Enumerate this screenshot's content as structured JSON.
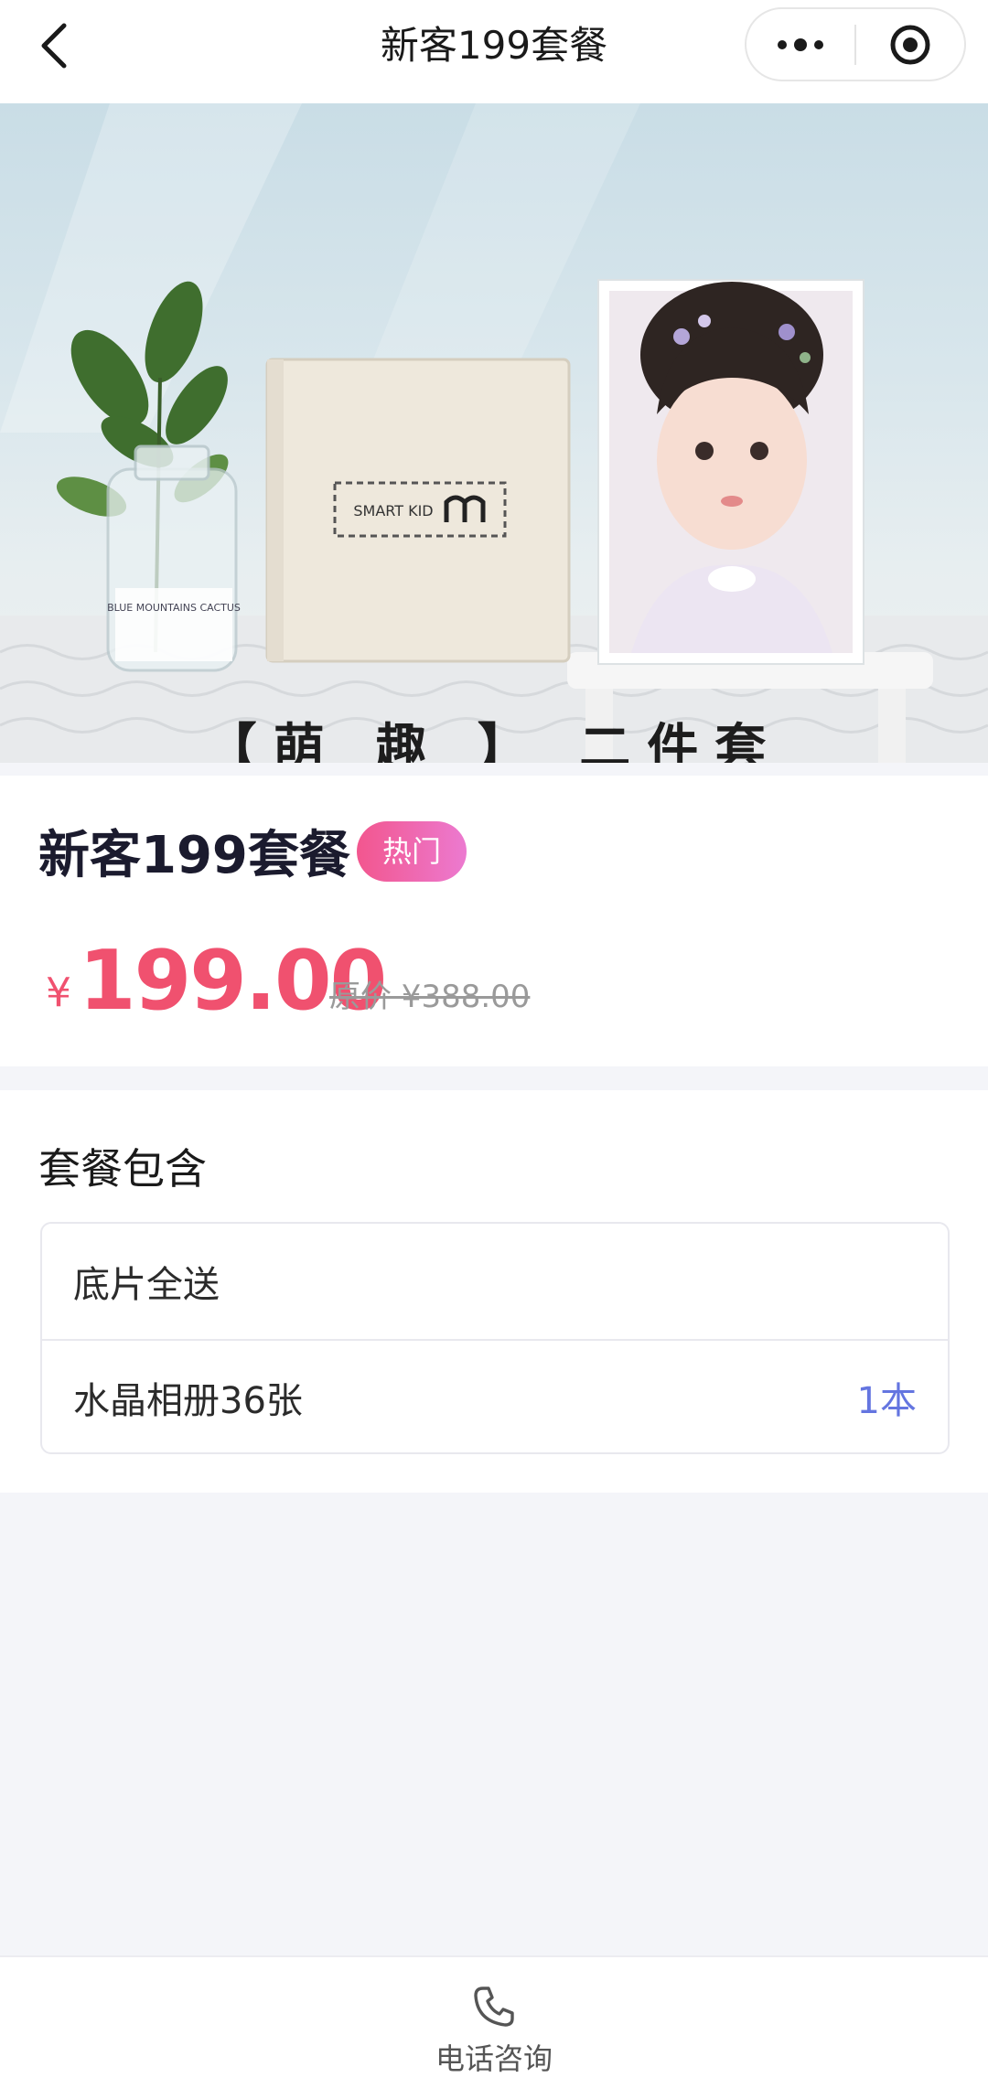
{
  "nav": {
    "title": "新客199套餐",
    "back_icon": "chevron-left-icon",
    "more_icon": "more-dots-icon",
    "close_icon": "target-circle-icon"
  },
  "banner": {
    "caption": "【萌 趣 】 二件套",
    "album_brand": "SMART KID",
    "vase_label": "BLUE MOUNTAINS CACTUS"
  },
  "package": {
    "title": "新客199套餐",
    "badge": "热门",
    "currency": "¥",
    "price": "199.00",
    "original_price": "原价 ¥388.00"
  },
  "contents": {
    "title": "套餐包含",
    "items": [
      {
        "name": "底片全送",
        "qty": ""
      },
      {
        "name": "水晶相册36张",
        "qty": "1本"
      }
    ]
  },
  "bottom": {
    "consult_label": "电话咨询",
    "consult_icon": "phone-icon"
  },
  "colors": {
    "accent_red": "#f0516f",
    "badge_gradient_start": "#f2568e",
    "badge_gradient_end": "#ec7ad0",
    "qty_blue": "#6475e0",
    "page_bg": "#f4f5f9"
  }
}
